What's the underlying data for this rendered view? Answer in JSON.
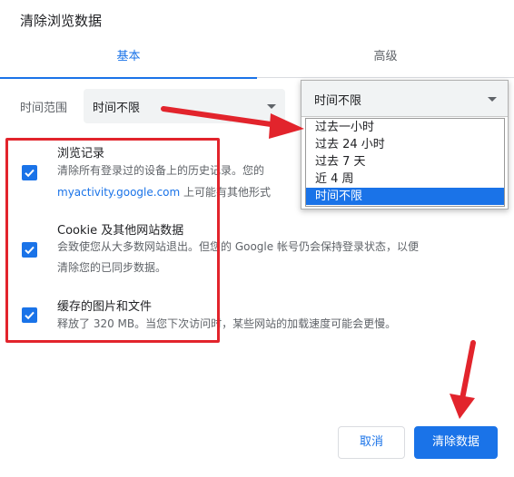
{
  "dialog": {
    "title": "清除浏览数据"
  },
  "tabs": [
    {
      "label": "基本",
      "active": true
    },
    {
      "label": "高级",
      "active": false
    }
  ],
  "time_range": {
    "label": "时间范围",
    "value": "时间不限"
  },
  "dropdown": {
    "selected": "时间不限",
    "options": [
      "过去一小时",
      "过去 24 小时",
      "过去 7 天",
      "近 4 周",
      "时间不限"
    ]
  },
  "items": [
    {
      "title": "浏览记录",
      "checked": true,
      "desc_line1": "清除所有登录过的设备上的历史记录。您的",
      "desc_link": "myactivity.google.com",
      "desc_line2_rest": " 上可能有其他形式"
    },
    {
      "title": "Cookie 及其他网站数据",
      "checked": true,
      "desc_line1": "会致使您从大多数网站退出。但您的 Google 帐号仍会保持登录状态，以便",
      "desc_line2": "清除您的已同步数据。"
    },
    {
      "title": "缓存的图片和文件",
      "checked": true,
      "desc_line1": "释放了 320 MB。当您下次访问时，某些网站的加载速度可能会更慢。"
    }
  ],
  "buttons": {
    "cancel": "取消",
    "clear": "清除数据"
  },
  "colors": {
    "accent": "#1a73e8",
    "annotation": "#e2242c"
  }
}
